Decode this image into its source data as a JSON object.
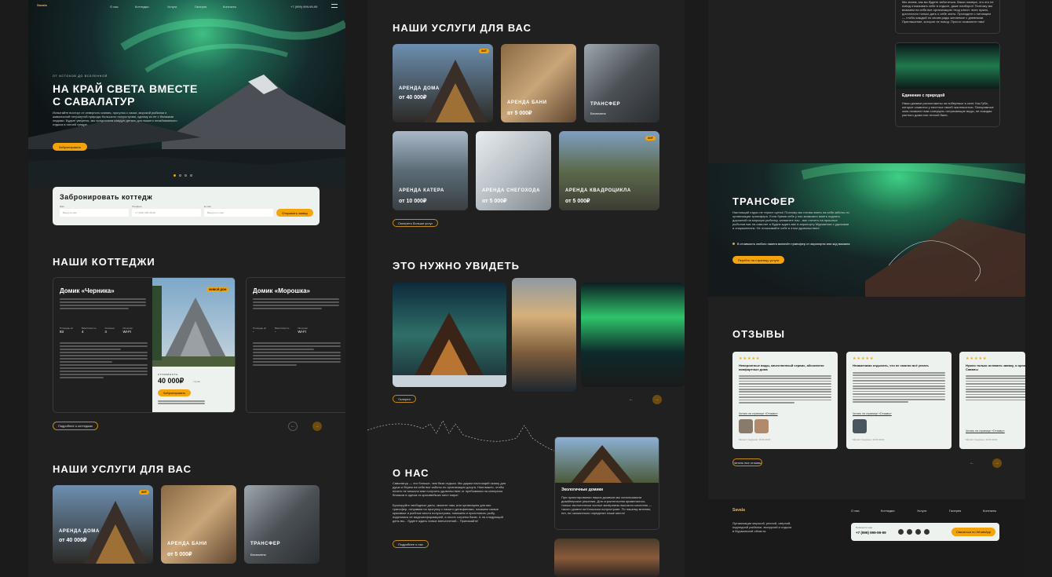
{
  "col1": {
    "nav": {
      "logo": "Savala",
      "items": [
        "О нас",
        "Коттеджи",
        "Услуги",
        "Галерея",
        "Контакты"
      ],
      "phone": "+7 (999) 999-99-99"
    },
    "hero": {
      "kicker": "от истоков до вселенной",
      "title_l1": "НА КРАЙ СВЕТА ВМЕСТЕ",
      "title_l2": "С САВАЛАТУР",
      "text": "Испытайте восторг от северного сияния, прогулок с хаски, морской рыбалки и живописной нетронутой природы Кольского полуострова, одному из ее с близкими людьми. Будьте уверены, мы предлагаем каждую деталь для вашего незабываемого отдыха в гончей тундре.",
      "button": "Забронировать"
    },
    "booking": {
      "title": "Забронировать коттедж",
      "f1_label": "Имя",
      "f1_ph": "Введите имя",
      "f2_label": "Телефон",
      "f2_ph": "+7 (999) 999-99-99",
      "f3_label": "E-mail",
      "f3_ph": "Введите e-mail",
      "submit": "Отправить заявку"
    },
    "cottages_title": "НАШИ КОТТЕДЖИ",
    "cottage1": {
      "name": "Домик «Черника»",
      "badge": "ЖИВОЙ ДОМ",
      "specs": [
        [
          "Площадь м²",
          "93"
        ],
        [
          "Вместимость",
          "4"
        ],
        [
          "Спальни",
          "4"
        ],
        [
          "Интернет",
          "Wi-Fi"
        ]
      ],
      "price_label": "СТОИМОСТЬ",
      "price": "40 000₽",
      "price_unit": "/ сутки",
      "button": "Забронировать"
    },
    "cottage2": {
      "name": "Домик «Морошка»",
      "specs": [
        [
          "Площадь м²",
          "-"
        ],
        [
          "Вместимость",
          "-"
        ],
        [
          "Спальни",
          "-"
        ],
        [
          "Интернет",
          "Wi-Fi"
        ]
      ]
    },
    "more_btn": "Подробнее о коттеджах",
    "services_title": "НАШИ УСЛУГИ ДЛЯ ВАС",
    "services": [
      {
        "title": "АРЕНДА ДОМА",
        "price": "от 40 000₽",
        "badge": "ХИТ"
      },
      {
        "title": "АРЕНДА БАНИ",
        "price": "от 5 000₽"
      },
      {
        "title": "ТРАНСФЕР",
        "price": "Бесплатно"
      }
    ]
  },
  "col2": {
    "services_title": "НАШИ УСЛУГИ ДЛЯ ВАС",
    "services": [
      {
        "title": "АРЕНДА ДОМА",
        "price": "от 40 000₽",
        "badge": "ХИТ"
      },
      {
        "title": "АРЕНДА БАНИ",
        "price": "от 5 000₽"
      },
      {
        "title": "ТРАНСФЕР",
        "price": "Бесплатно"
      },
      {
        "title": "АРЕНДА КАТЕРА",
        "price": "от 10 000₽"
      },
      {
        "title": "АРЕНДА СНЕГОХОДА",
        "price": "от 5 000₽"
      },
      {
        "title": "АРЕНДА КВАДРОЦИКЛА",
        "price": "от 5 000₽",
        "badge": "ХИТ"
      }
    ],
    "more_btn": "Смотреть больше услуг",
    "see_title": "ЭТО НУЖНО УВИДЕТЬ",
    "gallery_btn": "Галерея",
    "about": {
      "title": "О НАС",
      "text1": "Савалатур — это больше, чем база отдыха. Мы дарим настоящий сказку для души и берем на себя все заботы по организации досуга. Нам важно, чтобы ничего не мешало вам получать удовольствие от пребывания на северном близком в одном из красивейших мест мира!",
      "text2": "Бронируйте свободные даты, звоните нам, или организуем для вас трансфер, отправим на прогулку с хаски и дельфинами, покажем самые красивые и рыбные места полуострова, поможем и приготовить рыбу, поделимся ее видеоинформацией, а после согреем баню. А на следующий день вы... будете ждать новых впечатлений... Приезжайте!",
      "button": "Подробнее о нас",
      "card_title": "Экологичные домики",
      "card_text": "При проектировании наших домиков мы использовали дизайнерские решения. Для строительства применялось только экологически чистые материалы высокого качества — такого уровня на Кольском полуострове. По нашему мнению, нет, ни оказательно определят наше место!"
    }
  },
  "col3": {
    "top_card_text": "Мы знаем, как вы будете заботиться. Ваши номера, что это не повод отказывать себе в отдыхе, даже наоборот! Поэтому мы возьмем на себя все организацию «под ключ»: всех нужно, достаточно только дать о себе знать. Приходите с питомцем — чтобы каждый по своим ряды желаемое с дневными. Приглашение, которое не повод. Просто позвоните нам!",
    "unity_title": "Единение с природой",
    "unity_text": "Наши домики расположены на побережье в селе Уза-Губа, которое славится у местных своей экзотикостью. Панорамные окна позволят вам созерцать потрясающие виды, не покидая уютного дома или теплой бани.",
    "transfer": {
      "title": "ТРАНСФЕР",
      "text": "Настоящий отдых не терпит суеты! Поэтому мы готовы взять на себя заботы по организации трансфера. Если бремя себе у нас возможно иметь поднять дорожной на морскую рыбалку, захватите нас - вас гончего на прошлых рыболов вас на самолет и будем ждать вас в аэропорту Мурманска с удочками и снаряжением. Не отказывайте себе в этом удовольствии!",
      "bullet": "В стоимость любого пакета включён трансфер от аэропорта или ж/д вокзала",
      "button": "Перейти на страницу услуги"
    },
    "reviews_title": "ОТЗЫВЫ",
    "reviews": [
      {
        "stars": "★★★★★",
        "title": "Невероятные виды, качественный сервис, абсолютно комфортные дома",
        "link": "Читать на странице «Отзывы»",
        "date": "Михаил Андреев, 16.06.2023"
      },
      {
        "stars": "★★★★★",
        "title": "Незаменимо отдыхать, что не смогли всё уехать",
        "link": "Читать на странице «Отзывы»",
        "date": "Михаил Андреев, 16.06.2023"
      },
      {
        "stars": "★★★★★",
        "title": "Нужно только оставить заявку, и организуем компании Савалы",
        "link": "Читать на странице «Отзывы»",
        "date": "Михаил Андреев, 16.06.2023"
      }
    ],
    "reviews_btn": "Читать все отзывы",
    "footer": {
      "logo": "Savala",
      "desc": "Организация морской, речной, озерной, подледной рыбалки, экскурсий и отдыха в Мурманской области.",
      "nav": [
        "О нас",
        "Коттеджи",
        "Услуги",
        "Галерея",
        "Контакты"
      ],
      "call_label": "Позвоните нам",
      "phone": "+7 (999) 999-99-99",
      "whatsapp": "Связаться по WhatsApp"
    }
  },
  "colors": {
    "bg": "#1b1b1b",
    "panel": "#202020",
    "accent": "#f5a30a",
    "mint": "#eef2ee"
  }
}
